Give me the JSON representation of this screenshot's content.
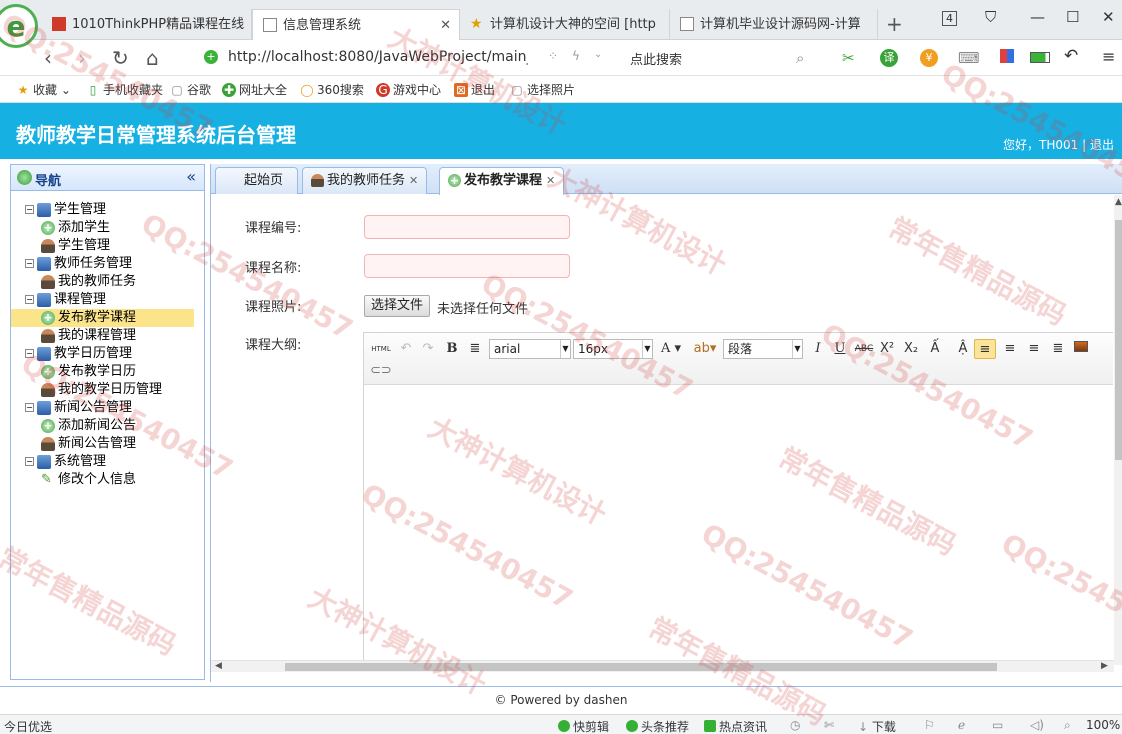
{
  "browser": {
    "tabs": [
      {
        "title": "1010ThinkPHP精品课程在线",
        "icon": "red-square-icon"
      },
      {
        "title": "信息管理系统",
        "icon": "page-icon"
      },
      {
        "title": "计算机设计大神的空间 [http",
        "icon": "star-icon"
      },
      {
        "title": "计算机毕业设计源码网-计算",
        "icon": "page-icon"
      }
    ],
    "tab_counter": "4",
    "url": "http://localhost:8080/JavaWebProject/main_",
    "search_label": "点此搜索",
    "bookmarks": [
      "收藏",
      "手机收藏夹",
      "谷歌",
      "网址大全",
      "360搜索",
      "游戏中心",
      "退出",
      "选择照片"
    ]
  },
  "app": {
    "title": "教师教学日常管理系统后台管理",
    "greeting": "您好，TH001",
    "separator": "|",
    "logout": "退出"
  },
  "sidebar": {
    "title": "导航",
    "tree": [
      {
        "label": "学生管理",
        "children": [
          {
            "label": "添加学生",
            "icon": "add"
          },
          {
            "label": "学生管理",
            "icon": "user"
          }
        ]
      },
      {
        "label": "教师任务管理",
        "children": [
          {
            "label": "我的教师任务",
            "icon": "user"
          }
        ]
      },
      {
        "label": "课程管理",
        "children": [
          {
            "label": "发布教学课程",
            "icon": "add"
          },
          {
            "label": "我的课程管理",
            "icon": "user"
          }
        ]
      },
      {
        "label": "教学日历管理",
        "children": [
          {
            "label": "发布教学日历",
            "icon": "add"
          },
          {
            "label": "我的教学日历管理",
            "icon": "user"
          }
        ]
      },
      {
        "label": "新闻公告管理",
        "children": [
          {
            "label": "添加新闻公告",
            "icon": "add"
          },
          {
            "label": "新闻公告管理",
            "icon": "user"
          }
        ]
      },
      {
        "label": "系统管理",
        "children": [
          {
            "label": "修改个人信息",
            "icon": "pen"
          }
        ]
      }
    ],
    "selected": "发布教学课程"
  },
  "main_tabs": [
    {
      "label": "起始页"
    },
    {
      "label": "我的教师任务"
    },
    {
      "label": "发布教学课程"
    }
  ],
  "form": {
    "course_no_label": "课程编号:",
    "course_name_label": "课程名称:",
    "course_photo_label": "课程照片:",
    "course_outline_label": "课程大纲:",
    "file_button": "选择文件",
    "file_hint": "未选择任何文件"
  },
  "editor": {
    "html_label": "HTML",
    "font_family": "arial",
    "font_size": "16px",
    "paragraph": "段落"
  },
  "footer": "© Powered by dashen",
  "statusbar": {
    "left": "今日优选",
    "items": [
      "快剪辑",
      "头条推荐",
      "热点资讯",
      "下载"
    ],
    "zoom": "100%"
  },
  "watermarks": [
    "QQ:254540457",
    "大神计算机设计",
    "常年售精品源码"
  ]
}
